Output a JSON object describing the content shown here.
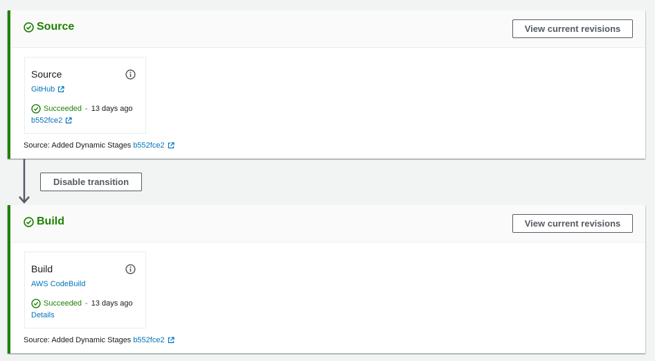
{
  "stages": {
    "source": {
      "title": "Source",
      "view_button": "View current revisions",
      "action": {
        "name": "Source",
        "provider": "GitHub",
        "status": "Succeeded",
        "separator": "-",
        "time_ago": "13 days ago",
        "commit": "b552fce2"
      },
      "footer": {
        "label": "Source: Added Dynamic Stages",
        "commit": "b552fce2"
      }
    },
    "build": {
      "title": "Build",
      "view_button": "View current revisions",
      "action": {
        "name": "Build",
        "provider": "AWS CodeBuild",
        "status": "Succeeded",
        "separator": "-",
        "time_ago": "13 days ago",
        "details": "Details"
      },
      "footer": {
        "label": "Source: Added Dynamic Stages",
        "commit": "b552fce2"
      }
    }
  },
  "transition": {
    "button": "Disable transition"
  },
  "icons": {
    "stage_status": "check-circle-icon",
    "info": "info-icon",
    "external": "external-link-icon",
    "arrow": "arrow-down-icon"
  },
  "colors": {
    "success": "#1d8102",
    "link": "#0073bb",
    "button_border": "#545b64",
    "background": "#f2f3f3"
  }
}
